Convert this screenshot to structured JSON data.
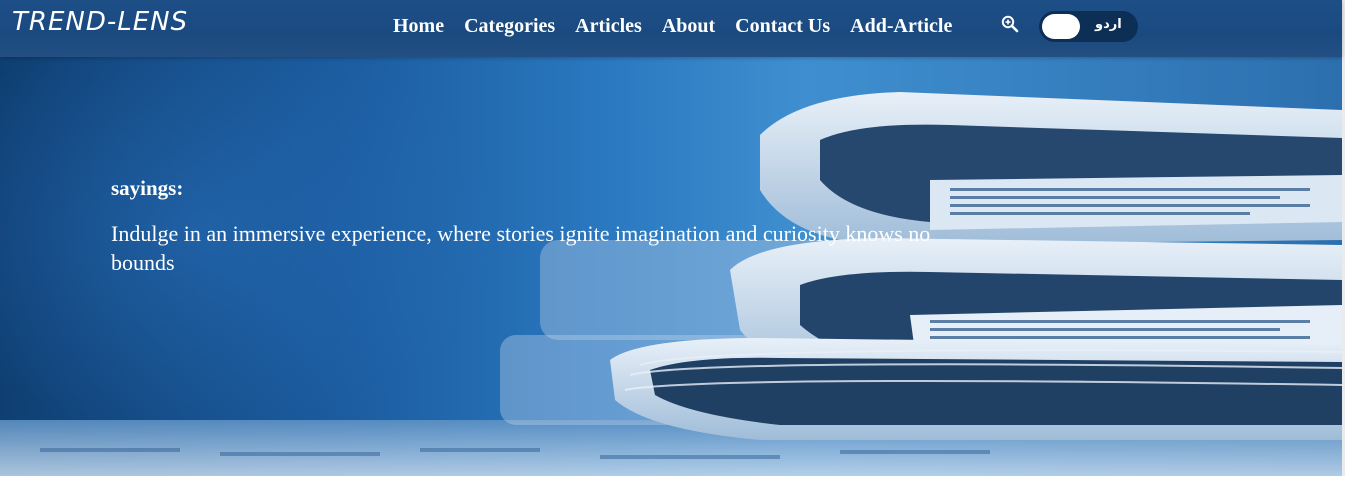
{
  "brand": "TREND-LENS",
  "nav": {
    "items": [
      "Home",
      "Categories",
      "Articles",
      "About",
      "Contact Us",
      "Add-Article"
    ],
    "search_icon": "zoom-in-icon",
    "language_toggle_label": "اردو"
  },
  "hero": {
    "heading": "sayings:",
    "text": "Indulge in an immersive experience, where stories ignite imagination and curiosity knows no bounds"
  },
  "colors": {
    "navbar": "#1d4e86",
    "hero_blue": "#2a78c0",
    "toggle_bg": "#0d2f55"
  }
}
